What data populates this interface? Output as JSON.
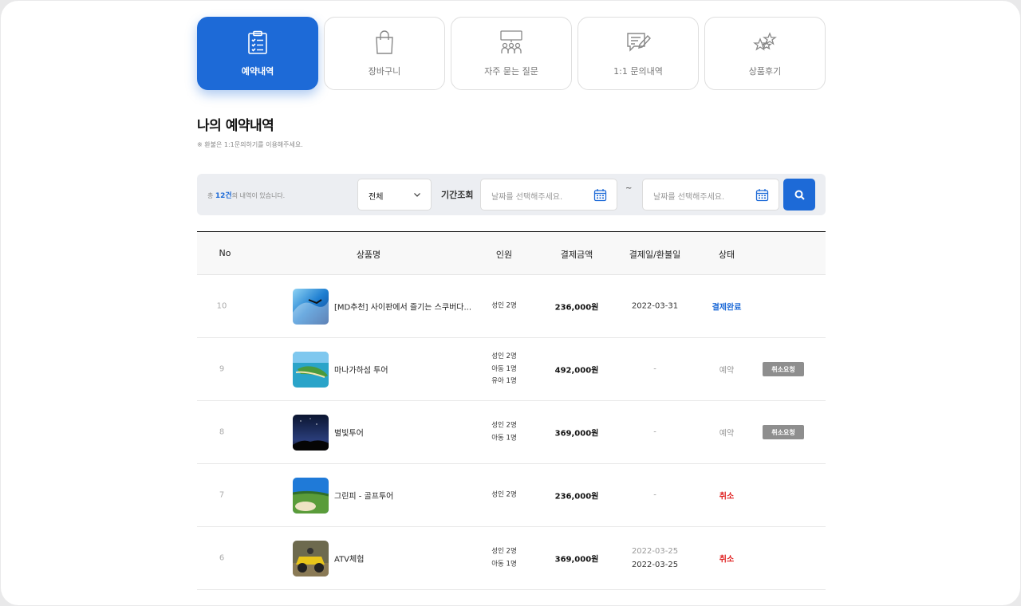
{
  "tabs": [
    {
      "label": "예약내역",
      "icon": "clipboard-checklist-icon",
      "active": true
    },
    {
      "label": "장바구니",
      "icon": "shopping-bag-icon",
      "active": false
    },
    {
      "label": "자주 묻는 질문",
      "icon": "faq-group-icon",
      "active": false
    },
    {
      "label": "1:1 문의내역",
      "icon": "chat-edit-icon",
      "active": false
    },
    {
      "label": "상품후기",
      "icon": "stars-icon",
      "active": false
    }
  ],
  "page": {
    "title": "나의 예약내역",
    "note": "※ 환불은 1:1문의하기를 이용해주세요."
  },
  "filter": {
    "total_prefix": "총 ",
    "total_count": "12건",
    "total_suffix": "의 내역이 있습니다.",
    "select_value": "전체",
    "period_label": "기간조회",
    "start_placeholder": "날짜를 선택해주세요.",
    "end_placeholder": "날짜를 선택해주세요.",
    "separator": "~"
  },
  "table": {
    "headers": [
      "No",
      "상품명",
      "인원",
      "결제금액",
      "결제일/환불일",
      "상태"
    ],
    "rows": [
      {
        "no": "10",
        "name": "[MD추천] 사이판에서 즐기는 스쿠버다...",
        "pax": [
          "성인 2명"
        ],
        "price": "236,000원",
        "date1": "2022-03-31",
        "date2": "",
        "status": "결제완료",
        "status_type": "done",
        "action": ""
      },
      {
        "no": "9",
        "name": "마나가하섬 투어",
        "pax": [
          "성인 2명",
          "아동 1명",
          "유아 1명"
        ],
        "price": "492,000원",
        "date1": "-",
        "date2": "",
        "status": "예약",
        "status_type": "reserved",
        "action": "취소요청"
      },
      {
        "no": "8",
        "name": "별빛투어",
        "pax": [
          "성인 2명",
          "아동 1명"
        ],
        "price": "369,000원",
        "date1": "-",
        "date2": "",
        "status": "예약",
        "status_type": "reserved",
        "action": "취소요청"
      },
      {
        "no": "7",
        "name": "그린피 - 골프투어",
        "pax": [
          "성인 2명"
        ],
        "price": "236,000원",
        "date1": "-",
        "date2": "",
        "status": "취소",
        "status_type": "cancel",
        "action": ""
      },
      {
        "no": "6",
        "name": "ATV체험",
        "pax": [
          "성인 2명",
          "아동 1명"
        ],
        "price": "369,000원",
        "date1": "2022-03-25",
        "date2": "2022-03-25",
        "status": "취소",
        "status_type": "cancel",
        "action": ""
      }
    ]
  },
  "colors": {
    "accent": "#1d6ad7",
    "cancel": "#e02020",
    "button_gray": "#8e8e8e"
  }
}
